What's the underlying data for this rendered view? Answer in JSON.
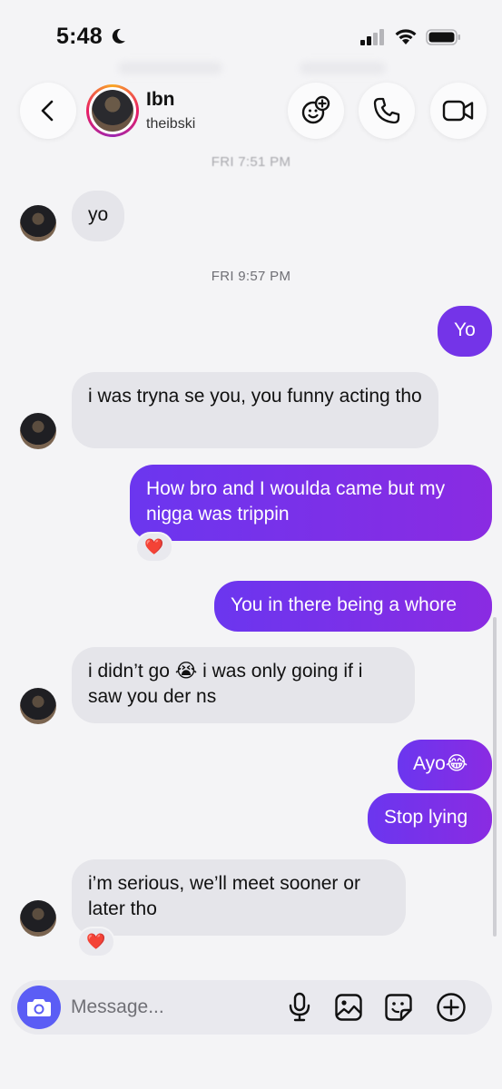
{
  "status_bar": {
    "time": "5:48"
  },
  "header": {
    "name": "Ibn",
    "handle": "theibski"
  },
  "timestamps": [
    "FRI 7:51 PM",
    "FRI 9:57 PM"
  ],
  "messages": [
    {
      "text": "yo"
    },
    {
      "text": "Yo"
    },
    {
      "text": "i was tryna se you, you funny acting tho"
    },
    {
      "text": "How bro and I woulda came but my nigga was trippin"
    },
    {
      "text": "You in there being a whore"
    },
    {
      "text": "i didn’t go 😭 i was only going if i saw you der ns"
    },
    {
      "text": "Ayo😂"
    },
    {
      "text": "Stop lying"
    },
    {
      "text": "i’m serious, we’ll meet sooner or later tho"
    }
  ],
  "reactions": {
    "heart": "❤️"
  },
  "composer": {
    "placeholder": "Message..."
  },
  "colors": {
    "accent": "#7434e8",
    "camera": "#5b5df5",
    "incoming_bubble": "#e5e5ea"
  },
  "icons": [
    "moon-icon",
    "signal-icon",
    "wifi-icon",
    "battery-icon",
    "back-icon",
    "effects-icon",
    "phone-icon",
    "video-icon",
    "camera-icon",
    "microphone-icon",
    "gallery-icon",
    "sticker-icon",
    "plus-icon"
  ]
}
